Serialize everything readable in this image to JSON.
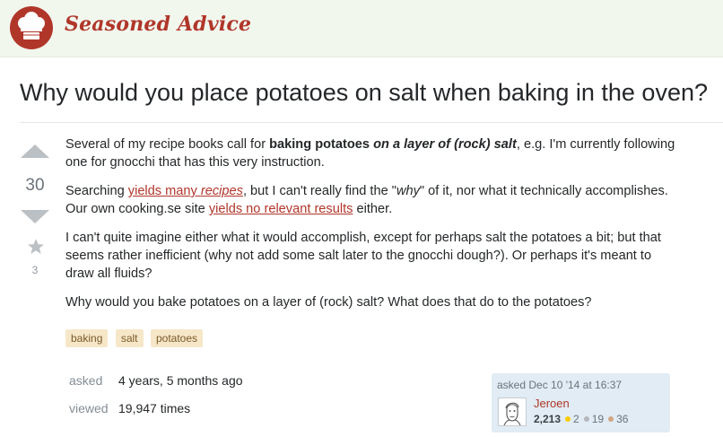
{
  "site": {
    "name": "Seasoned Advice",
    "accent": "#b0362a",
    "header_bg": "#f2f7ee",
    "logo_icon": "chef-hat-icon"
  },
  "question": {
    "title": "Why would you place potatoes on salt when baking in the oven?",
    "votes": "30",
    "favorites": "3",
    "body": {
      "p1": {
        "a": "Several of my recipe books call for ",
        "b": "baking potatoes ",
        "c": "on a layer of (rock) salt",
        "d": ", e.g. I'm currently following one for gnocchi that has this very instruction."
      },
      "p2": {
        "a": "Searching ",
        "link1": "yields many ",
        "link1_em": "recipes",
        "b": ", but I can't really find the \"",
        "why": "why",
        "c": "\" of it, nor what it technically accomplishes. Our own cooking.se site ",
        "link2": "yields no relevant results",
        "d": " either."
      },
      "p3": "I can't quite imagine either what it would accomplish, except for perhaps salt the potatoes a bit; but that seems rather inefficient (why not add some salt later to the gnocchi dough?). Or perhaps it's meant to draw all fluids?",
      "p4": "Why would you bake potatoes on a layer of (rock) salt? What does that do to the potatoes?"
    },
    "tags": [
      "baking",
      "salt",
      "potatoes"
    ]
  },
  "stats": {
    "asked_label": "asked",
    "asked_value": "4 years, 5 months ago",
    "viewed_label": "viewed",
    "viewed_value": "19,947 times"
  },
  "owner": {
    "asked_time": "asked Dec 10 '14 at 16:37",
    "name": "Jeroen",
    "reputation": "2,213",
    "gold": "2",
    "silver": "19",
    "bronze": "36",
    "gold_color": "#ffcc01",
    "silver_color": "#b4b8bc",
    "bronze_color": "#d1a684"
  }
}
